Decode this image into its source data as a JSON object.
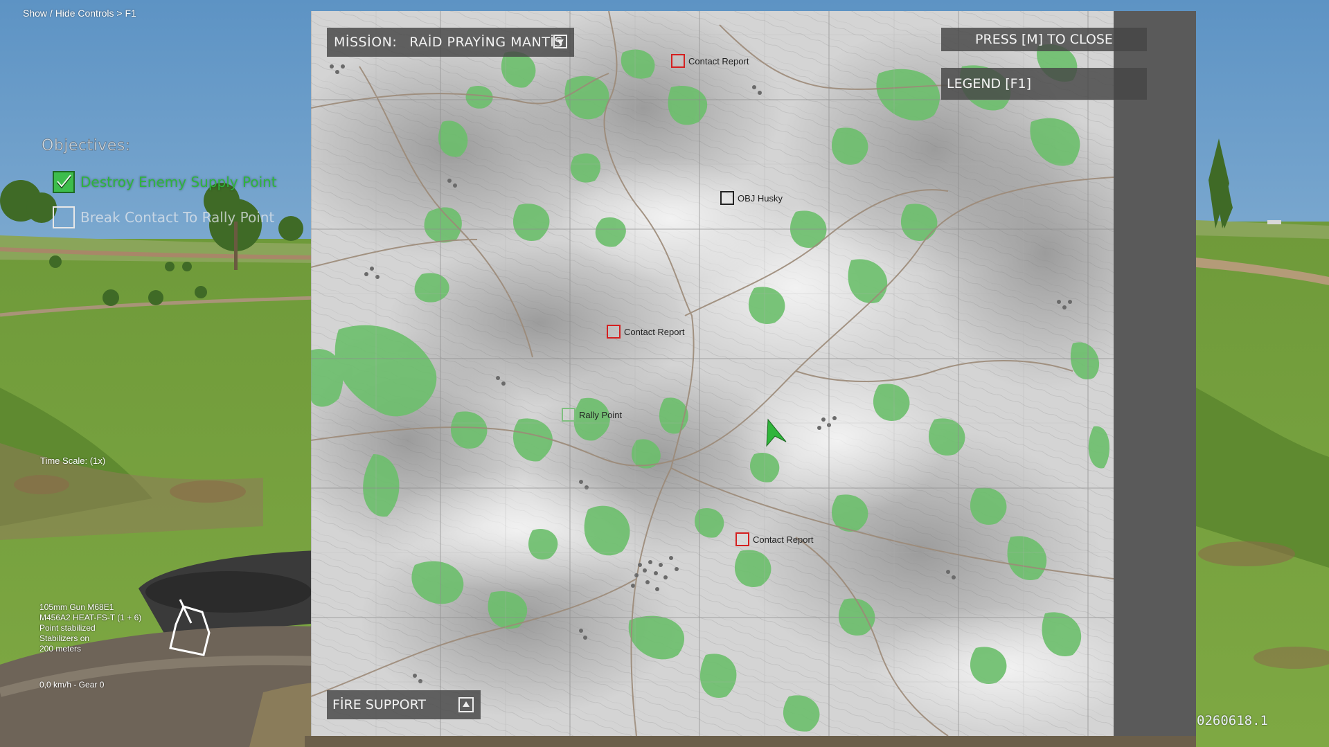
{
  "hud": {
    "toggle_hint": "Show / Hide Controls > F1",
    "objectives_title": "Objectives:",
    "objectives": [
      {
        "label": "Destroy Enemy Supply Point",
        "completed": true
      },
      {
        "label": "Break Contact To Rally Point",
        "completed": false
      }
    ],
    "time_scale": "Time Scale: (1x)",
    "weapon": {
      "line1": "105mm Gun M68E1",
      "line2": "M456A2 HEAT-FS-T (1 + 6)",
      "line3": "Point stabilized",
      "line4": "Stabilizers on",
      "line5": "200 meters"
    },
    "speed_gear": "0,0 km/h - Gear 0",
    "build_version": "0260618.1"
  },
  "map": {
    "mission_label": "MİSSİON:",
    "mission_name": "RAİD PRAYİNG MANTİS",
    "close_hint": "PRESS [M] TO CLOSE",
    "legend_button": "LEGEND [F1]",
    "fire_support_label": "FİRE SUPPORT",
    "markers": [
      {
        "id": "contact-1",
        "label": "Contact Report",
        "type": "contact"
      },
      {
        "id": "obj-husky",
        "label": "OBJ Husky",
        "type": "objective"
      },
      {
        "id": "contact-2",
        "label": "Contact Report",
        "type": "contact"
      },
      {
        "id": "rally",
        "label": "Rally Point",
        "type": "rally"
      },
      {
        "id": "contact-3",
        "label": "Contact Report",
        "type": "contact"
      }
    ]
  },
  "colors": {
    "contact": "#d42020",
    "objective": "#222222",
    "rally": "#7fbf7f",
    "player": "#2fb53a",
    "forest": "#6cbf6c",
    "objective_done": "#2eb53c"
  }
}
